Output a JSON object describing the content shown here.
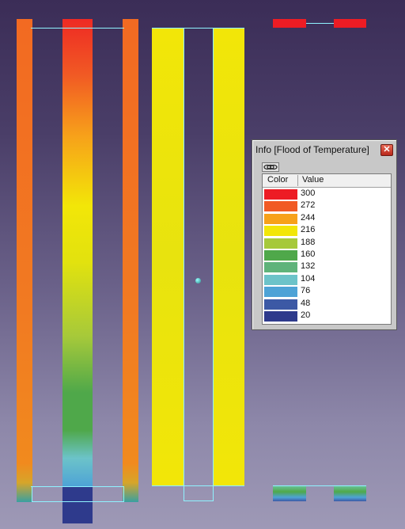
{
  "info_panel": {
    "title": "Info [Flood of Temperature]",
    "close_label": "✕",
    "toolbar_icon": "link-icon",
    "columns": {
      "color": "Color",
      "value": "Value"
    },
    "legend": [
      {
        "color": "#ed1c24",
        "value": "300"
      },
      {
        "color": "#f15a24",
        "value": "272"
      },
      {
        "color": "#f7a11a",
        "value": "244"
      },
      {
        "color": "#f2e608",
        "value": "216"
      },
      {
        "color": "#a6c93a",
        "value": "188"
      },
      {
        "color": "#4fa84a",
        "value": "160"
      },
      {
        "color": "#5fb37a",
        "value": "132"
      },
      {
        "color": "#6cc3c9",
        "value": "104"
      },
      {
        "color": "#4ea3d6",
        "value": "76"
      },
      {
        "color": "#3c59a5",
        "value": "48"
      },
      {
        "color": "#2e3a8c",
        "value": "20"
      }
    ]
  },
  "colors": {
    "outline": "#8ff3ff",
    "background_top": "#3b2d57",
    "background_bottom": "#9e99b6"
  }
}
